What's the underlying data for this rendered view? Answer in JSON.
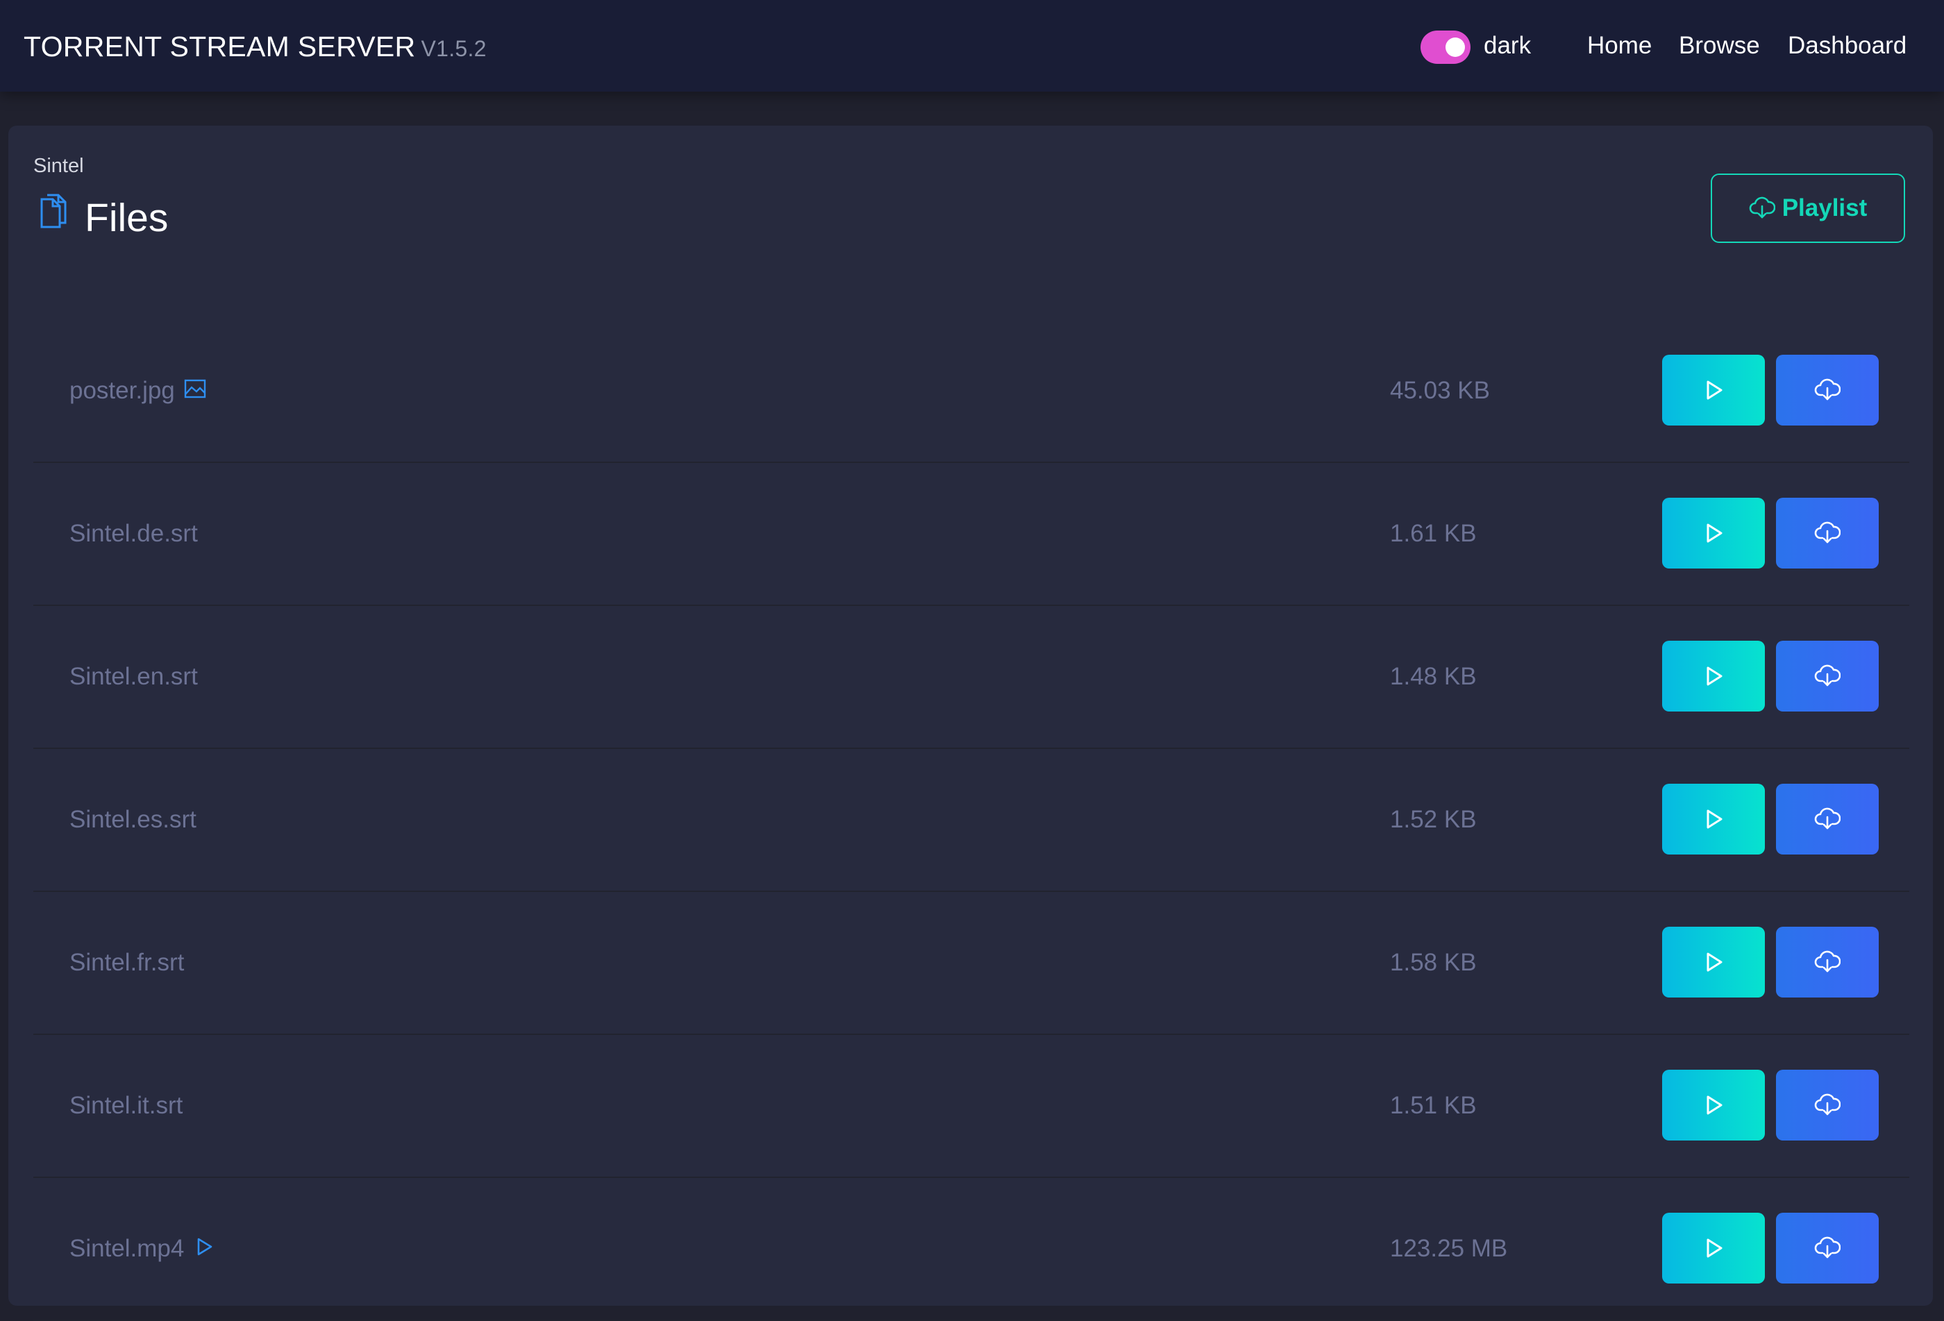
{
  "app": {
    "title": "TORRENT STREAM SERVER",
    "version": "V1.5.2"
  },
  "theme_toggle": {
    "label": "dark",
    "enabled": true,
    "color": "#e04ed0"
  },
  "nav": {
    "home": "Home",
    "browse": "Browse",
    "dashboard": "Dashboard"
  },
  "page": {
    "breadcrumb": "Sintel",
    "title": "Files",
    "title_icon": "files-icon",
    "playlist_button": {
      "label": "Playlist",
      "icon": "cloud-download-icon",
      "color": "#14d8b8"
    }
  },
  "files": [
    {
      "name": "poster.jpg",
      "size": "45.03 KB",
      "type_icon": "image-icon"
    },
    {
      "name": "Sintel.de.srt",
      "size": "1.61 KB",
      "type_icon": ""
    },
    {
      "name": "Sintel.en.srt",
      "size": "1.48 KB",
      "type_icon": ""
    },
    {
      "name": "Sintel.es.srt",
      "size": "1.52 KB",
      "type_icon": ""
    },
    {
      "name": "Sintel.fr.srt",
      "size": "1.58 KB",
      "type_icon": ""
    },
    {
      "name": "Sintel.it.srt",
      "size": "1.51 KB",
      "type_icon": ""
    },
    {
      "name": "Sintel.mp4",
      "size": "123.25 MB",
      "type_icon": "play-icon"
    }
  ],
  "row_actions": {
    "play_icon": "play-icon",
    "download_icon": "cloud-download-icon",
    "play_color": "#06b9e2",
    "download_color": "#2b73ec"
  }
}
